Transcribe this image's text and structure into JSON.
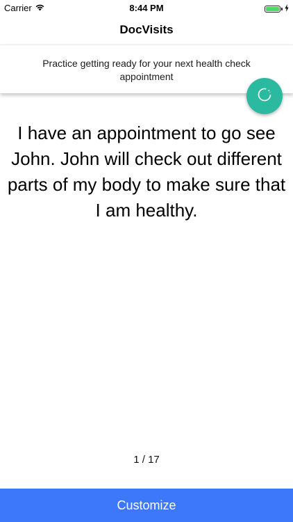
{
  "status_bar": {
    "carrier": "Carrier",
    "time": "8:44 PM",
    "wifi_icon": "wifi-icon",
    "battery_icon": "battery-icon",
    "charging_icon": "charging-bolt-icon",
    "battery_level": 1.0,
    "battery_color": "#4cd964"
  },
  "nav": {
    "title": "DocVisits"
  },
  "banner": {
    "text": "Practice getting ready for your next health check appointment"
  },
  "fab": {
    "icon": "refresh-icon",
    "color": "#2bb9a0"
  },
  "main": {
    "message": "I have an appointment to go see John. John will check out different parts of my body to make sure that I am healthy."
  },
  "pager": {
    "counter": "1 / 17"
  },
  "footer": {
    "customize_label": "Customize",
    "button_color": "#3d78fb"
  }
}
